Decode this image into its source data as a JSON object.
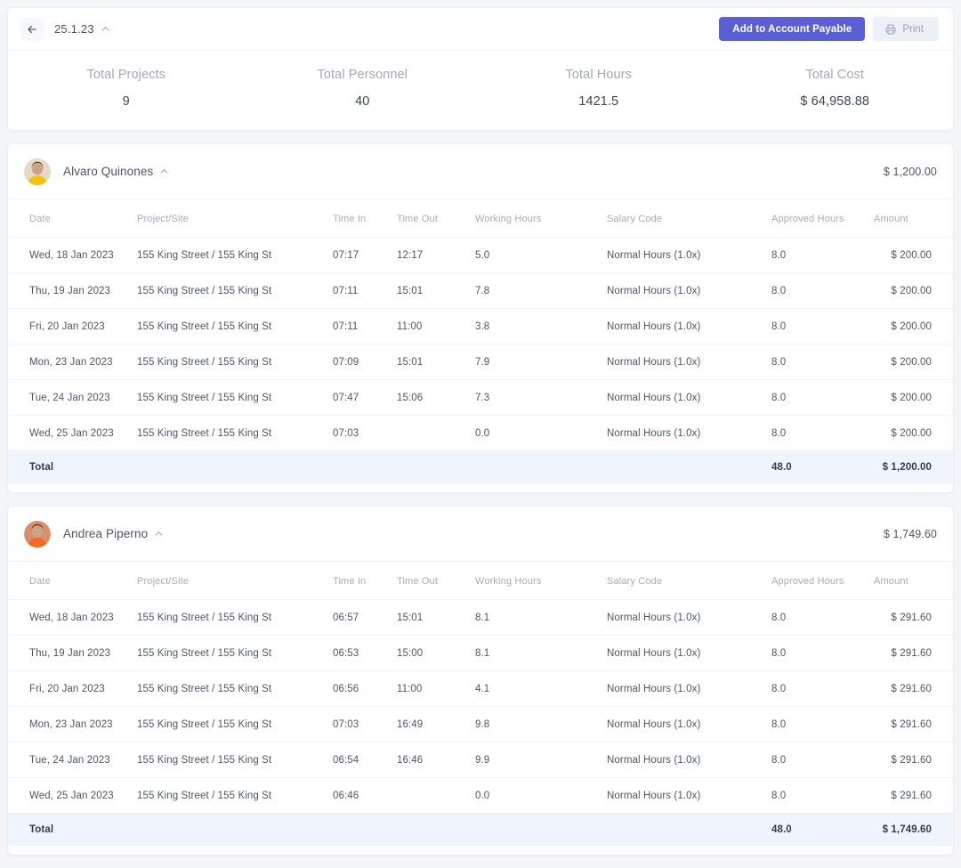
{
  "toolbar": {
    "back_icon": "arrow-left-icon",
    "title": "25.1.23",
    "collapse_icon": "chevron-up-icon",
    "primary_button": "Add to Account Payable",
    "print_button": "Print",
    "print_icon": "printer-icon",
    "accent_color": "#5a5fd4",
    "ghost_bg": "#eef0f7"
  },
  "summary": [
    {
      "label": "Total Projects",
      "value": "9"
    },
    {
      "label": "Total Personnel",
      "value": "40"
    },
    {
      "label": "Total Hours",
      "value": "1421.5"
    },
    {
      "label": "Total Cost",
      "value": "$ 64,958.88"
    }
  ],
  "columns": [
    "Date",
    "Project/Site",
    "Time In",
    "Time Out",
    "Working Hours",
    "Salary Code",
    "Approved Hours",
    "Amount"
  ],
  "total_label": "Total",
  "link_color": "#7e84d6",
  "total_row_bg": "#eef5fd",
  "people": [
    {
      "name": "Alvaro Quinones",
      "amount": "$ 1,200.00",
      "avatar_colors": [
        "#e8d9c4",
        "#f2c312",
        "#3d3430"
      ],
      "rows": [
        {
          "date": "Wed, 18 Jan 2023",
          "site": "155 King Street / 155 King St",
          "in": "07:17",
          "out": "12:17",
          "work": "5.0",
          "salary": "Normal Hours (1.0x)",
          "approved": "8.0",
          "amount": "$ 200.00"
        },
        {
          "date": "Thu, 19 Jan 2023",
          "site": "155 King Street / 155 King St",
          "in": "07:11",
          "out": "15:01",
          "work": "7.8",
          "salary": "Normal Hours (1.0x)",
          "approved": "8.0",
          "amount": "$ 200.00"
        },
        {
          "date": "Fri, 20 Jan 2023",
          "site": "155 King Street / 155 King St",
          "in": "07:11",
          "out": "11:00",
          "work": "3.8",
          "salary": "Normal Hours (1.0x)",
          "approved": "8.0",
          "amount": "$ 200.00"
        },
        {
          "date": "Mon, 23 Jan 2023",
          "site": "155 King Street / 155 King St",
          "in": "07:09",
          "out": "15:01",
          "work": "7.9",
          "salary": "Normal Hours (1.0x)",
          "approved": "8.0",
          "amount": "$ 200.00"
        },
        {
          "date": "Tue, 24 Jan 2023",
          "site": "155 King Street / 155 King St",
          "in": "07:47",
          "out": "15:06",
          "work": "7.3",
          "salary": "Normal Hours (1.0x)",
          "approved": "8.0",
          "amount": "$ 200.00"
        },
        {
          "date": "Wed, 25 Jan 2023",
          "site": "155 King Street / 155 King St",
          "in": "07:03",
          "out": "",
          "work": "0.0",
          "salary": "Normal Hours (1.0x)",
          "approved": "8.0",
          "amount": "$ 200.00"
        }
      ],
      "total": {
        "approved": "48.0",
        "amount": "$ 1,200.00"
      }
    },
    {
      "name": "Andrea Piperno",
      "amount": "$ 1,749.60",
      "avatar_colors": [
        "#d9906a",
        "#f06a21",
        "#4a342a"
      ],
      "rows": [
        {
          "date": "Wed, 18 Jan 2023",
          "site": "155 King Street / 155 King St",
          "in": "06:57",
          "out": "15:01",
          "work": "8.1",
          "salary": "Normal Hours (1.0x)",
          "approved": "8.0",
          "amount": "$ 291.60"
        },
        {
          "date": "Thu, 19 Jan 2023",
          "site": "155 King Street / 155 King St",
          "in": "06:53",
          "out": "15:00",
          "work": "8.1",
          "salary": "Normal Hours (1.0x)",
          "approved": "8.0",
          "amount": "$ 291.60"
        },
        {
          "date": "Fri, 20 Jan 2023",
          "site": "155 King Street / 155 King St",
          "in": "06:56",
          "out": "11:00",
          "work": "4.1",
          "salary": "Normal Hours (1.0x)",
          "approved": "8.0",
          "amount": "$ 291.60"
        },
        {
          "date": "Mon, 23 Jan 2023",
          "site": "155 King Street / 155 King St",
          "in": "07:03",
          "out": "16:49",
          "work": "9.8",
          "salary": "Normal Hours (1.0x)",
          "approved": "8.0",
          "amount": "$ 291.60"
        },
        {
          "date": "Tue, 24 Jan 2023",
          "site": "155 King Street / 155 King St",
          "in": "06:54",
          "out": "16:46",
          "work": "9.9",
          "salary": "Normal Hours (1.0x)",
          "approved": "8.0",
          "amount": "$ 291.60"
        },
        {
          "date": "Wed, 25 Jan 2023",
          "site": "155 King Street / 155 King St",
          "in": "06:46",
          "out": "",
          "work": "0.0",
          "salary": "Normal Hours (1.0x)",
          "approved": "8.0",
          "amount": "$ 291.60"
        }
      ],
      "total": {
        "approved": "48.0",
        "amount": "$ 1,749.60"
      }
    }
  ]
}
